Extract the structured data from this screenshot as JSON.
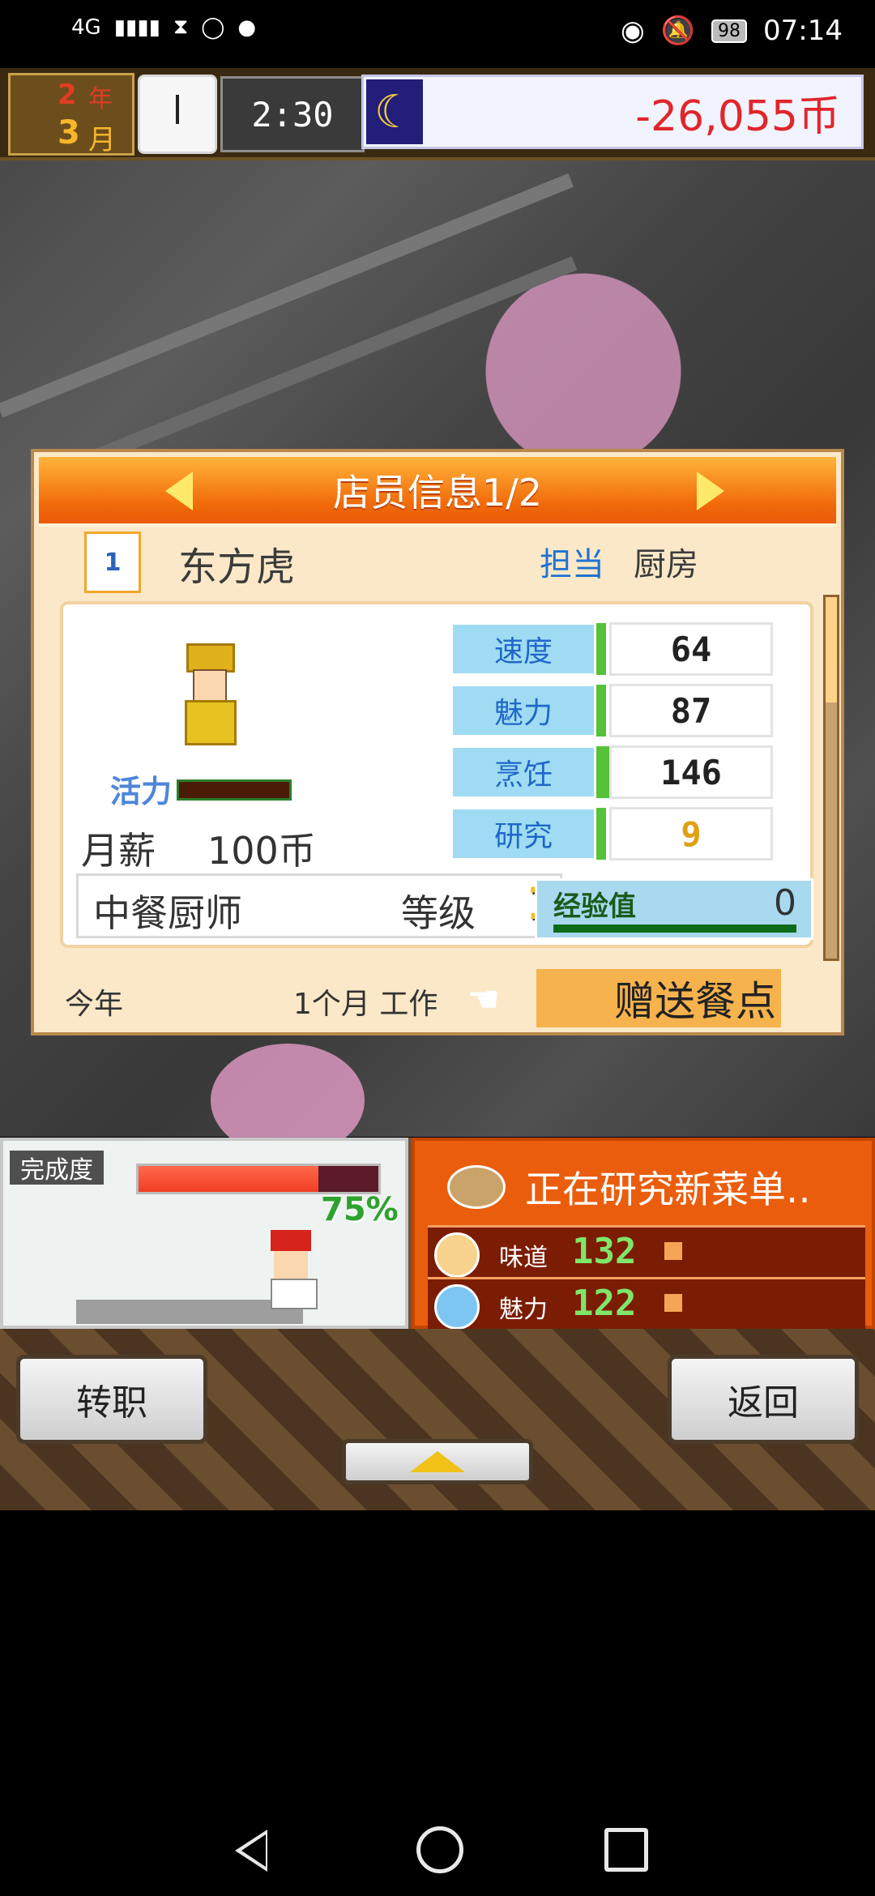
{
  "status_bar": {
    "network": "4G",
    "signal_icon": "signal-icon",
    "icons": [
      "hourglass-icon",
      "sync-icon",
      "message-icon"
    ],
    "right_icons": [
      "eye-icon",
      "mute-icon"
    ],
    "battery": "98",
    "time": "07:14"
  },
  "hud": {
    "year_number": "2",
    "year_unit": "年",
    "month_number": "3",
    "month_unit": "月",
    "time": "2:30",
    "night_icon": "moon-icon",
    "money": "-26,055币"
  },
  "dialog": {
    "title": "店员信息1/2",
    "rank": "1",
    "name": "东方虎",
    "role_label": "担当",
    "role_value": "厨房",
    "vitality_label": "活力",
    "salary_label": "月薪",
    "salary_value": "100币",
    "stats": [
      {
        "label": "速度",
        "value": "64"
      },
      {
        "label": "魅力",
        "value": "87"
      },
      {
        "label": "烹饪",
        "value": "146"
      },
      {
        "label": "研究",
        "value": "9"
      }
    ],
    "job": "中餐厨师",
    "level_label": "等级",
    "level_value": "1",
    "exp_label": "经验值",
    "exp_value": "0",
    "this_year": "今年",
    "months_worked": "1个月 工作",
    "gift_button": "赠送餐点"
  },
  "bottom_panel": {
    "completion_label": "完成度",
    "completion_value": "75%",
    "completion_fraction": 0.75,
    "research_title": "正在研究新菜单‥",
    "research_rows": [
      {
        "label": "味道",
        "value": "132"
      },
      {
        "label": "魅力",
        "value": "122"
      }
    ],
    "buttons": {
      "change_job": "转职",
      "back": "返回"
    }
  },
  "colors": {
    "accent_orange": "#f16b0a",
    "money_red": "#e0262b",
    "stat_label_blue": "#9fdcf3",
    "gauge_green": "#55c23a"
  }
}
